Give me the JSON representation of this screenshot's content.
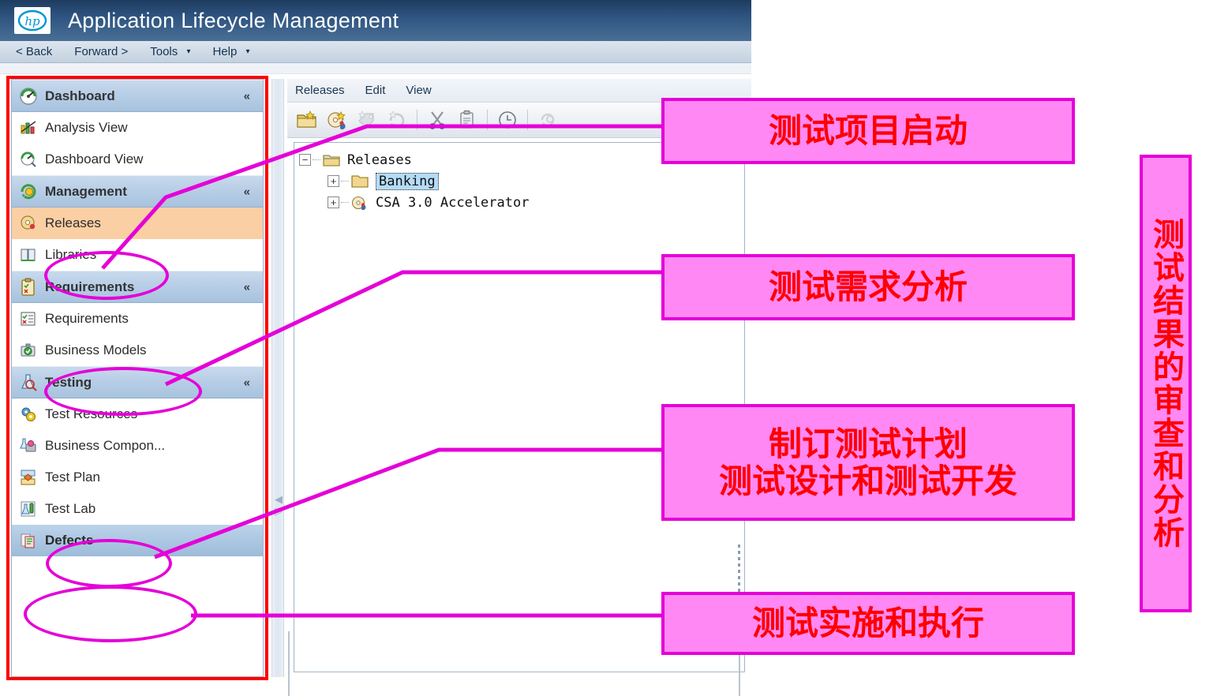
{
  "app": {
    "title": "Application Lifecycle Management",
    "logo_icon": "hp-logo-icon"
  },
  "menubar": {
    "items": [
      {
        "label": "< Back",
        "caret": false
      },
      {
        "label": "Forward >",
        "caret": false
      },
      {
        "label": "Tools",
        "caret": true
      },
      {
        "label": "Help",
        "caret": true
      }
    ]
  },
  "sidebar": {
    "groups": [
      {
        "label": "Dashboard",
        "icon": "dashboard-gauge-icon",
        "collapse_glyph": "«",
        "items": [
          {
            "label": "Analysis View",
            "icon": "analysis-view-icon",
            "state": "normal"
          },
          {
            "label": "Dashboard View",
            "icon": "dashboard-view-icon",
            "state": "normal"
          }
        ]
      },
      {
        "label": "Management",
        "icon": "management-icon",
        "collapse_glyph": "«",
        "items": [
          {
            "label": "Releases",
            "icon": "releases-icon",
            "state": "selected-orange"
          },
          {
            "label": "Libraries",
            "icon": "libraries-icon",
            "state": "normal"
          }
        ]
      },
      {
        "label": "Requirements",
        "icon": "requirements-clipboard-icon",
        "collapse_glyph": "«",
        "items": [
          {
            "label": "Requirements",
            "icon": "requirements-list-icon",
            "state": "normal"
          },
          {
            "label": "Business Models",
            "icon": "business-models-icon",
            "state": "normal"
          }
        ]
      },
      {
        "label": "Testing",
        "icon": "testing-flask-icon",
        "collapse_glyph": "«",
        "items": [
          {
            "label": "Test Resources",
            "icon": "test-resources-icon",
            "state": "normal"
          },
          {
            "label": "Business Compon...",
            "icon": "business-components-icon",
            "state": "normal"
          },
          {
            "label": "Test Plan",
            "icon": "test-plan-icon",
            "state": "normal"
          },
          {
            "label": "Test Lab",
            "icon": "test-lab-icon",
            "state": "normal"
          },
          {
            "label": "Defects",
            "icon": "defects-icon",
            "state": "selected-blue"
          }
        ]
      }
    ]
  },
  "splitter": {
    "collapse_left_glyph": "◀",
    "expand_right_glyph": "▷"
  },
  "main": {
    "menu": [
      "Releases",
      "Edit",
      "View"
    ],
    "toolbar": [
      {
        "icon": "new-release-folder-icon",
        "enabled": true
      },
      {
        "icon": "new-release-icon",
        "enabled": true
      },
      {
        "icon": "new-milestone-tag-icon",
        "enabled": false
      },
      {
        "icon": "new-cycle-refresh-icon",
        "enabled": false
      },
      {
        "sep": true
      },
      {
        "icon": "cut-scissors-icon",
        "enabled": true
      },
      {
        "icon": "paste-clipboard-icon",
        "enabled": true
      },
      {
        "sep": true
      },
      {
        "icon": "history-clock-icon",
        "enabled": true
      },
      {
        "sep": true
      },
      {
        "icon": "refresh-all-icon",
        "enabled": false
      }
    ],
    "tree": [
      {
        "label": "Releases",
        "icon": "open-folder-icon",
        "expander": "−",
        "level": 1,
        "selected": false
      },
      {
        "label": "Banking",
        "icon": "closed-folder-icon",
        "expander": "+",
        "level": 2,
        "selected": true
      },
      {
        "label": "CSA 3.0 Accelerator",
        "icon": "release-disc-icon",
        "expander": "+",
        "level": 2,
        "selected": false
      }
    ]
  },
  "annotations": {
    "callouts": [
      {
        "id": "callout-1",
        "text": "测试项目启动"
      },
      {
        "id": "callout-2",
        "text": "测试需求分析"
      },
      {
        "id": "callout-3",
        "line1": "制订测试计划",
        "line2": "测试设计和测试开发"
      },
      {
        "id": "callout-4",
        "text": "测试实施和执行"
      }
    ],
    "vertical_callout": {
      "text": "测试结果的审查和分析"
    }
  },
  "colors": {
    "annotation_fill": "#ff88f4",
    "annotation_border": "#e500d8",
    "annotation_text": "#ff0000",
    "highlight_box": "#ff0000",
    "selected_row_orange": "#fbcfa4",
    "titlebar_blue": "#2d5480"
  }
}
